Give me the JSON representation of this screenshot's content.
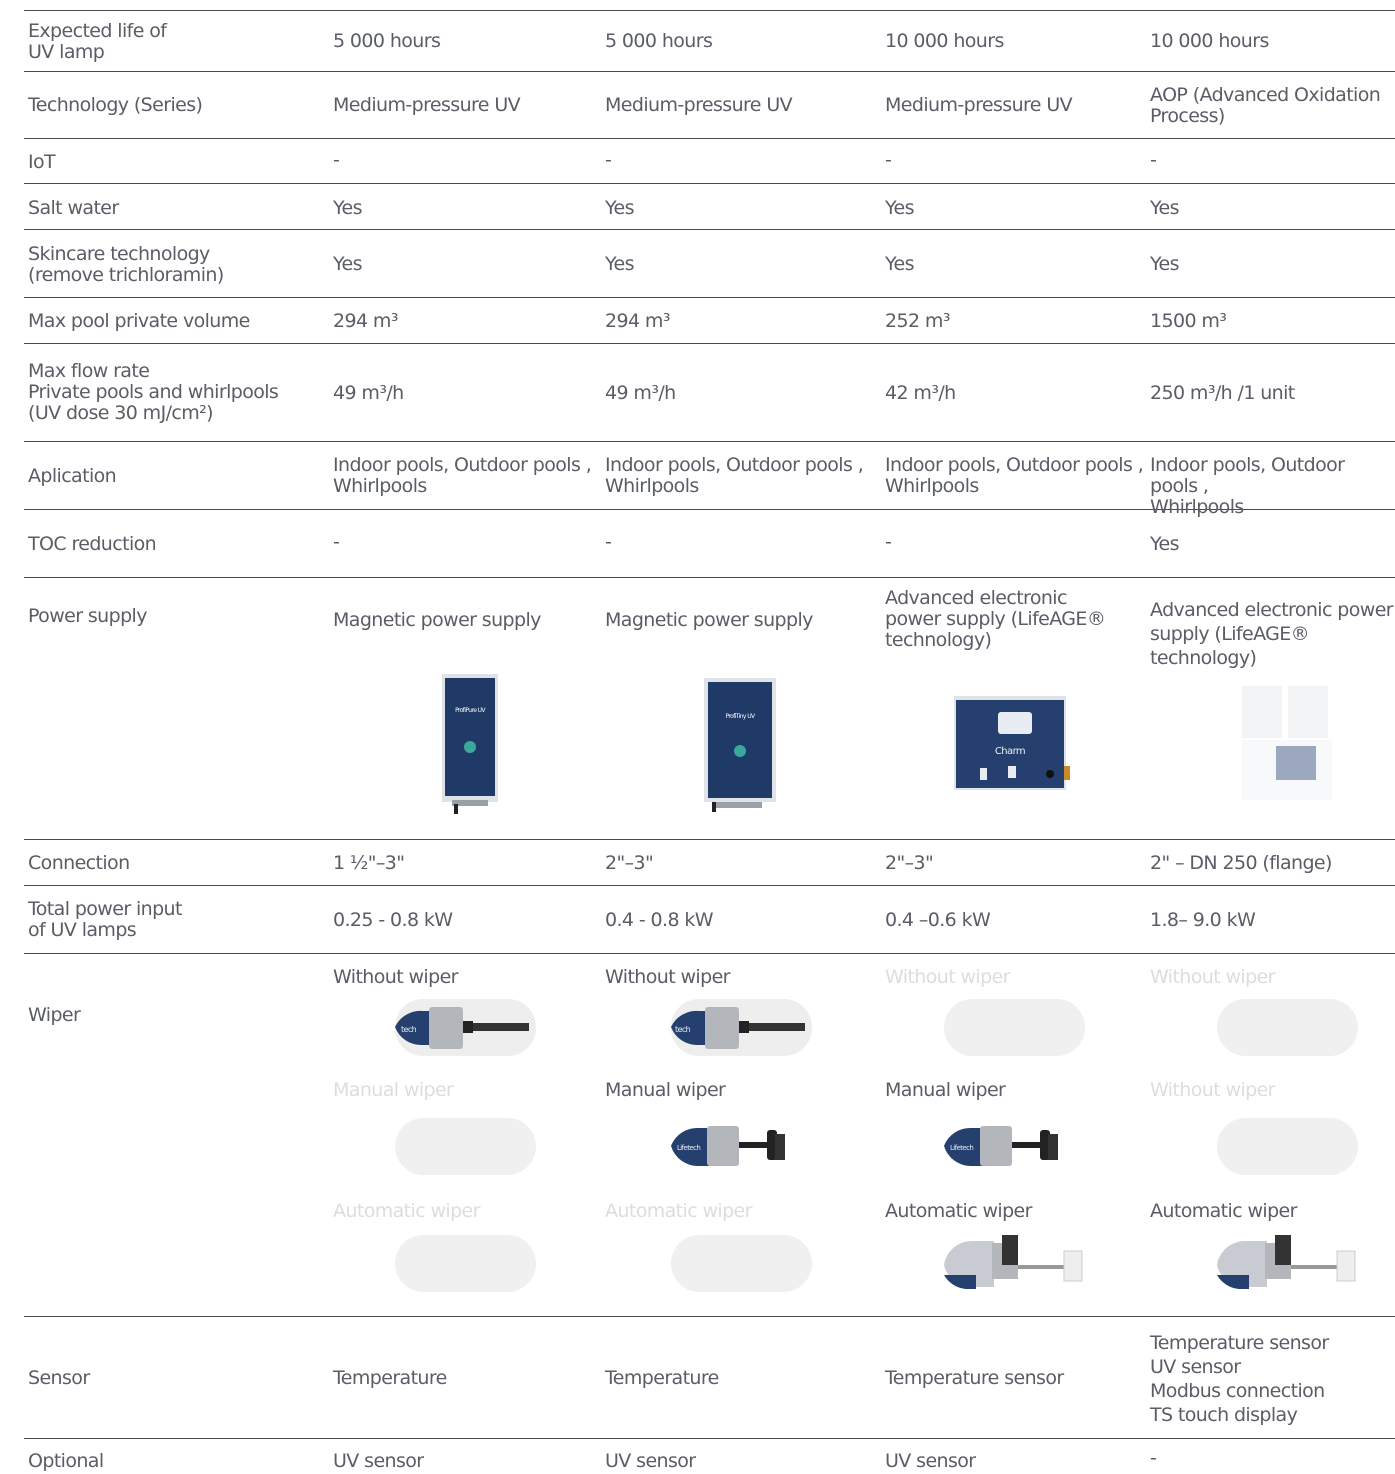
{
  "rows": {
    "lamp_life": {
      "label": "Expected life of\nUV lamp",
      "v": [
        "5 000 hours",
        "5 000 hours",
        "10 000 hours",
        "10 000 hours"
      ]
    },
    "technology": {
      "label": "Technology (Series)",
      "v": [
        "Medium-pressure UV",
        "Medium-pressure UV",
        "Medium-pressure UV",
        "AOP (Advanced Oxidation\nProcess)"
      ]
    },
    "iot": {
      "label": "IoT",
      "v": [
        "-",
        "-",
        "-",
        "-"
      ]
    },
    "salt": {
      "label": "Salt water",
      "v": [
        "Yes",
        "Yes",
        "Yes",
        "Yes"
      ]
    },
    "skincare": {
      "label": "Skincare technology\n(remove trichloramin)",
      "v": [
        "Yes",
        "Yes",
        "Yes",
        "Yes"
      ]
    },
    "volume": {
      "label": "Max pool private volume",
      "v": [
        "294 m³",
        "294 m³",
        "252 m³",
        "1500 m³"
      ]
    },
    "flow": {
      "label": "Max flow rate\nPrivate pools and whirlpools\n(UV dose 30 mJ/cm²)",
      "v": [
        "49 m³/h",
        "49 m³/h",
        "42 m³/h",
        "250 m³/h  /1 unit"
      ]
    },
    "application": {
      "label": "Aplication",
      "v": [
        "Indoor pools, Outdoor pools ,\nWhirlpools",
        "Indoor pools, Outdoor pools ,\nWhirlpools",
        "Indoor pools, Outdoor pools ,\nWhirlpools",
        "Indoor pools, Outdoor pools ,\nWhirlpools"
      ]
    },
    "toc": {
      "label": "TOC reduction",
      "v": [
        "-",
        "-",
        "-",
        "Yes"
      ]
    },
    "power": {
      "label": "Power supply",
      "v": [
        "Magnetic power supply",
        "Magnetic power supply",
        "Advanced electronic\npower supply (LifeAGE®\ntechnology)",
        "Advanced electronic power\nsupply (LifeAGE® technology)"
      ]
    },
    "connection": {
      "label": "Connection",
      "v": [
        "1 ½\"–3\"",
        "2\"–3\"",
        "2\"–3\"",
        "2\" – DN 250 (flange)"
      ]
    },
    "power_input": {
      "label": "Total power input\nof UV lamps",
      "v": [
        "0.25 - 0.8 kW",
        "0.4 - 0.8 kW",
        "0.4 –0.6 kW",
        "1.8– 9.0 kW"
      ]
    },
    "wiper": {
      "label": "Wiper",
      "top": [
        "Without wiper",
        "Without wiper",
        "Without wiper",
        "Without wiper"
      ],
      "mid": [
        "Manual wiper",
        "Manual wiper",
        "Manual wiper",
        "Without wiper"
      ],
      "bot": [
        "Automatic wiper",
        "Automatic wiper",
        "Automatic wiper",
        "Automatic wiper"
      ]
    },
    "sensor": {
      "label": "Sensor",
      "v": [
        "Temperature",
        "Temperature",
        "Temperature sensor",
        "Temperature sensor\nUV sensor\nModbus connection\nTS touch display"
      ]
    },
    "optional": {
      "label": "Optional",
      "v": [
        "UV sensor",
        "UV sensor",
        "UV sensor",
        "-"
      ]
    }
  },
  "devices": {
    "d1_title": "ProfiPure UV",
    "d2_title": "ProfiTiny UV",
    "d3_title": "Charm"
  },
  "wiper_brand": [
    "tech",
    "tech",
    "Lifetech",
    "Lifetech"
  ]
}
